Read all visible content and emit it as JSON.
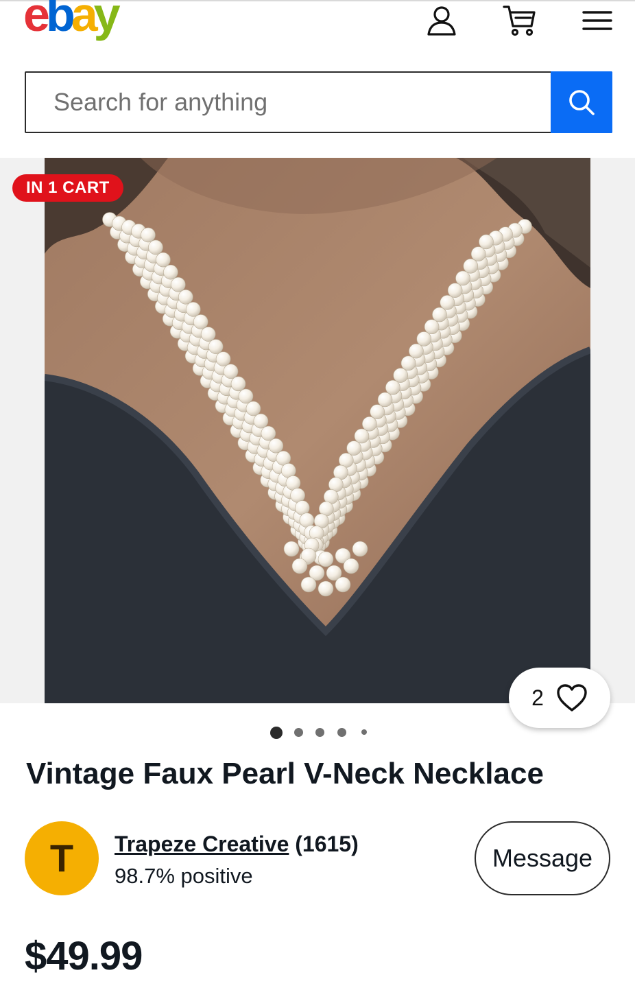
{
  "header": {
    "logo_letters": [
      "e",
      "b",
      "a",
      "y"
    ],
    "logo_colors": [
      "#e53238",
      "#0064d2",
      "#f5af02",
      "#86b817"
    ],
    "icons": [
      "account-icon",
      "cart-icon",
      "menu-icon"
    ]
  },
  "search": {
    "placeholder": "Search for anything",
    "button_icon": "search-icon",
    "button_color": "#0a6cf5"
  },
  "gallery": {
    "badge": "IN 1 CART",
    "badge_color": "#e0121b",
    "watch_count": "2",
    "watch_icon": "heart-icon",
    "image_count": 5,
    "active_index": 0
  },
  "item": {
    "title": "Vintage Faux Pearl V-Neck Necklace",
    "price": "$49.99"
  },
  "seller": {
    "avatar_letter": "T",
    "avatar_color": "#f5af02",
    "name": "Trapeze Creative",
    "feedback_count": "(1615)",
    "positive": "98.7% positive",
    "message_label": "Message"
  }
}
